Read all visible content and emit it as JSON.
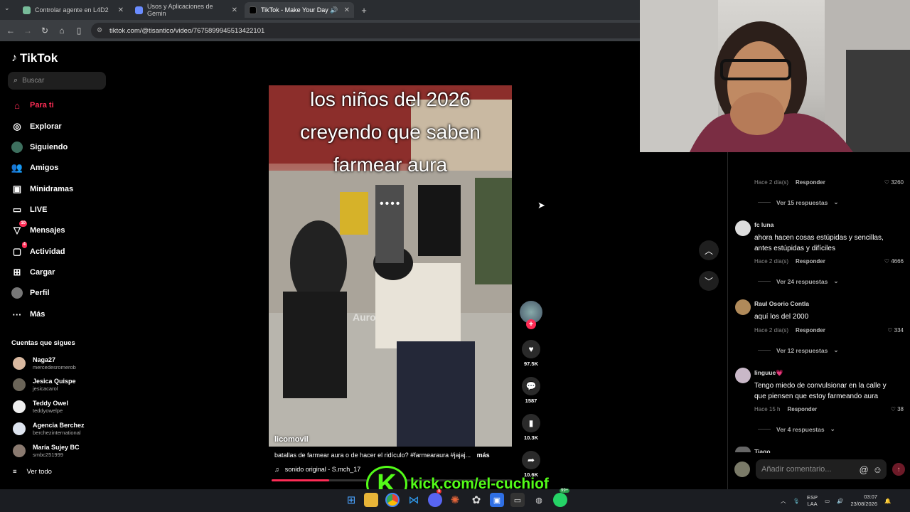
{
  "browser": {
    "tabs": [
      {
        "label": "Controlar agente en L4D2"
      },
      {
        "label": "Usos y Aplicaciones de Gemin"
      },
      {
        "label": "TikTok - Make Your Day"
      }
    ],
    "new_tab": "+",
    "url": "tiktok.com/@tisantico/video/7675899945513422101"
  },
  "sidebar": {
    "logo": "TikTok",
    "search_placeholder": "Buscar",
    "nav": [
      {
        "label": "Para ti",
        "icon": "home-icon"
      },
      {
        "label": "Explorar",
        "icon": "compass-icon"
      },
      {
        "label": "Siguiendo",
        "icon": "following-icon"
      },
      {
        "label": "Amigos",
        "icon": "friends-icon"
      },
      {
        "label": "Minidramas",
        "icon": "minidramas-icon"
      },
      {
        "label": "LIVE",
        "icon": "live-icon"
      },
      {
        "label": "Mensajes",
        "icon": "messages-icon",
        "badge": "10"
      },
      {
        "label": "Actividad",
        "icon": "activity-icon",
        "badge": "4"
      },
      {
        "label": "Cargar",
        "icon": "upload-icon"
      },
      {
        "label": "Perfil",
        "icon": "profile-icon"
      },
      {
        "label": "Más",
        "icon": "more-icon"
      }
    ],
    "following_title": "Cuentas que sigues",
    "accounts": [
      {
        "name": "Naga27",
        "handle": "mercedesromerob"
      },
      {
        "name": "Jesica Quispe",
        "handle": "jesicacarol"
      },
      {
        "name": "Teddy Owel",
        "handle": "teddyowelpe"
      },
      {
        "name": "Agencia Berchez",
        "handle": "berchezinternational"
      },
      {
        "name": "María Sujey BC",
        "handle": "smbc251999"
      }
    ],
    "see_all": "Ver todo"
  },
  "video": {
    "caption_lines": [
      "los niños del 2026",
      "creyendo que saben",
      "farmear aura"
    ],
    "watermark": "Auro",
    "username": "licomovil",
    "description": "batallas de farmear aura o de hacer el ridículo? #farmearaura #jajaj...",
    "more": "más",
    "sound": "sonido original - S.mch_17",
    "progress": 0.24,
    "likes": "97.5K",
    "comments": "1587",
    "saves": "10.3K",
    "shares": "10.6K"
  },
  "comments": {
    "top_meta": {
      "time": "Hace 2 día(s)",
      "reply": "Responder",
      "likes": "3260"
    },
    "top_more": "Ver 15 respuestas",
    "items": [
      {
        "user": "fc luna",
        "text": "ahora hacen cosas estúpidas y sencillas, antes estúpidas y difíciles",
        "time": "Hace 2 día(s)",
        "reply": "Responder",
        "likes": "4666",
        "more": "Ver 24 respuestas"
      },
      {
        "user": "Raul Osorio Contla",
        "text": "aquí los del 2000",
        "time": "Hace 2 día(s)",
        "reply": "Responder",
        "likes": "334",
        "more": "Ver 12 respuestas"
      },
      {
        "user": "linguue💗",
        "text": "Tengo miedo de convulsionar en la calle y que piensen que estoy farmeando aura",
        "time": "Hace 15 h",
        "reply": "Responder",
        "likes": "38",
        "more": "Ver 4 respuestas"
      },
      {
        "user": "Tiago"
      }
    ],
    "input_placeholder": "Añadir comentario..."
  },
  "overlay": {
    "kick_letter": "K",
    "kick_text": "kick.com/el-cuchiof"
  },
  "taskbar": {
    "lang": "ESP",
    "region": "LAA",
    "time": "03:07",
    "date": "23/08/2026",
    "discord_badge": "9",
    "whatsapp_badge": "99+"
  }
}
